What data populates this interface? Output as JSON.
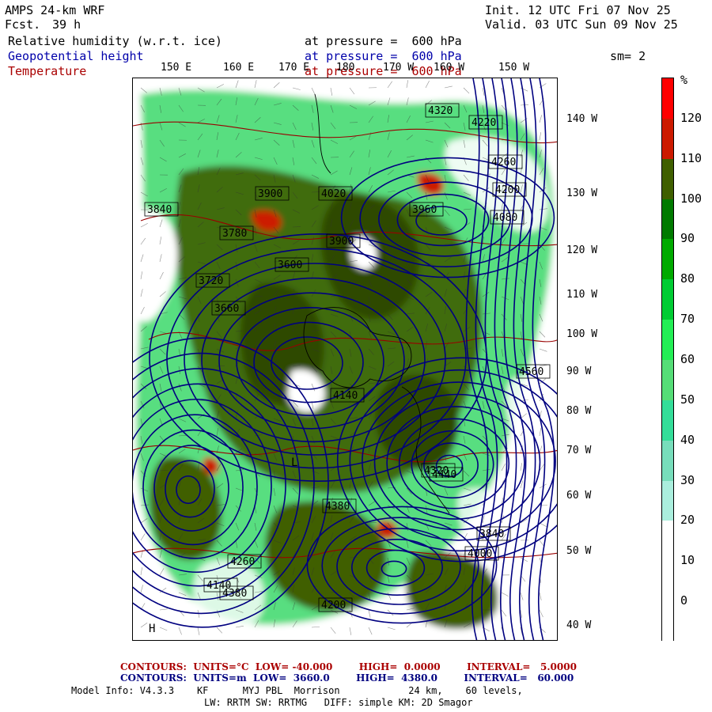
{
  "header": {
    "model": "AMPS 24-km WRF",
    "fcst_label": "Fcst.",
    "fcst_hours": "39 h",
    "init": "Init. 12 UTC Fri 07 Nov 25",
    "valid": "Valid. 03 UTC Sun 09 Nov 25",
    "smoothing": "sm= 2"
  },
  "fields": [
    {
      "name": "Relative humidity (w.r.t. ice)",
      "level": "at pressure =  600 hPa",
      "color": "#000000"
    },
    {
      "name": "Geopotential height",
      "level": "at pressure =  600 hPa",
      "color": "#0000aa"
    },
    {
      "name": "Temperature",
      "level": "at pressure =  600 hPa",
      "color": "#aa0000"
    }
  ],
  "map": {
    "top_longitudes": [
      "150 E",
      "160 E",
      "170 E",
      "180",
      "170 W",
      "160 W",
      "150 W"
    ],
    "right_longitudes": [
      "140 W",
      "130 W",
      "120 W",
      "110 W",
      "100 W",
      "90 W",
      "80 W",
      "70 W",
      "60 W",
      "50 W",
      "40 W"
    ],
    "height_labels": [
      "4320",
      "4220",
      "4260",
      "4200",
      "4080",
      "3960",
      "3840",
      "3900",
      "4020",
      "3780",
      "3720",
      "3660",
      "3600",
      "3900",
      "4140",
      "4380",
      "4440",
      "4260",
      "4200",
      "4320",
      "4560",
      "3840",
      "4000",
      "4140",
      "4380"
    ],
    "symbols": [
      {
        "text": "L",
        "kind": "low"
      },
      {
        "text": "H",
        "kind": "high"
      }
    ]
  },
  "colorbar": {
    "unit": "%",
    "labels": [
      "120",
      "110",
      "100",
      "90",
      "80",
      "70",
      "60",
      "50",
      "40",
      "30",
      "20",
      "10",
      "0"
    ],
    "colors": [
      "#ff0000",
      "#cc1a00",
      "#3f5f00",
      "#007a00",
      "#00aa00",
      "#00cc33",
      "#22ee55",
      "#55dd77",
      "#33dd99",
      "#77ddbb",
      "#aaeedd",
      "#ffffff",
      "#ffffff",
      "#ffffff"
    ]
  },
  "footer": {
    "temp_contours": "CONTOURS:  UNITS=°C  LOW= -40.000        HIGH=  0.0000        INTERVAL=   5.0000",
    "height_contours": "CONTOURS:  UNITS=m  LOW=  3660.0        HIGH=  4380.0        INTERVAL=   60.000",
    "model_info": "Model Info: V4.3.3    KF      MYJ PBL  Morrison            24 km,    60 levels,",
    "model_info2": "LW: RRTM SW: RRTMG   DIFF: simple KM: 2D Smagor"
  }
}
